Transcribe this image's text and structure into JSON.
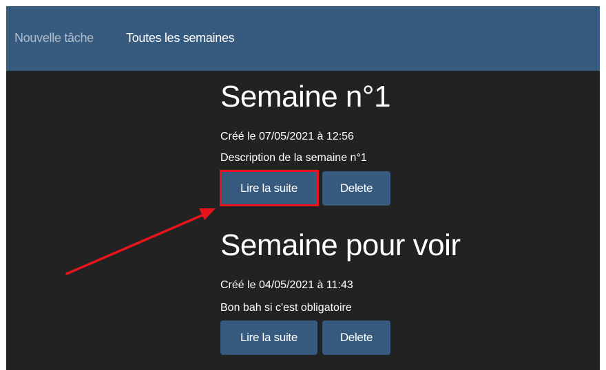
{
  "navbar": {
    "new_task": "Nouvelle tâche",
    "all_weeks": "Toutes les semaines"
  },
  "weeks": [
    {
      "title": "Semaine n°1",
      "created": "Créé le 07/05/2021 à 12:56",
      "description": "Description de la semaine n°1",
      "read_more_label": "Lire la suite",
      "delete_label": "Delete"
    },
    {
      "title": "Semaine pour voir",
      "created": "Créé le 04/05/2021 à 11:43",
      "description": "Bon bah si c'est obligatoire",
      "read_more_label": "Lire la suite",
      "delete_label": "Delete"
    }
  ],
  "colors": {
    "navbar": "#375a7f",
    "background": "#222222",
    "button": "#375a7f",
    "annotation": "#e8141b"
  }
}
